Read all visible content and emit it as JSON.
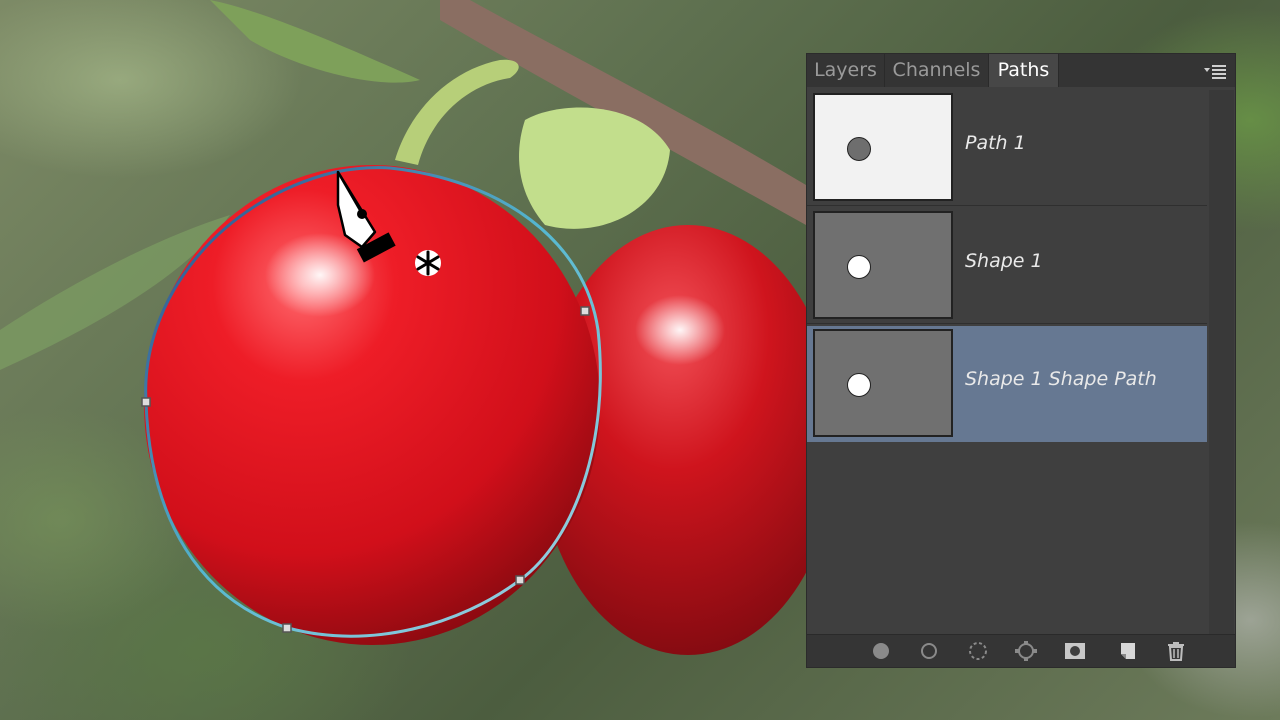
{
  "panel": {
    "tabs": [
      {
        "label": "Layers",
        "active": false
      },
      {
        "label": "Channels",
        "active": false
      },
      {
        "label": "Paths",
        "active": true
      }
    ],
    "menu_icon": "panel-menu-icon",
    "paths": [
      {
        "label": "Path 1",
        "thumb_bg": "#f2f2f2",
        "thumb_dot": "#6e6e6e",
        "selected": false
      },
      {
        "label": "Shape 1",
        "thumb_bg": "#707070",
        "thumb_dot": "#ffffff",
        "selected": false
      },
      {
        "label": "Shape 1 Shape Path",
        "thumb_bg": "#707070",
        "thumb_dot": "#ffffff",
        "selected": true
      }
    ],
    "footer_buttons": [
      {
        "name": "fill-path-icon"
      },
      {
        "name": "stroke-path-icon"
      },
      {
        "name": "load-selection-icon"
      },
      {
        "name": "make-work-path-icon"
      },
      {
        "name": "add-mask-icon"
      },
      {
        "name": "new-path-icon"
      },
      {
        "name": "delete-path-icon"
      }
    ]
  },
  "colors": {
    "selection_highlight": "#667892",
    "path_stroke": "#66c8d8",
    "cherry": "#e0141f"
  },
  "tool": {
    "cursor": "pen-tool-icon",
    "modifier": "asterisk-new-path-icon"
  }
}
